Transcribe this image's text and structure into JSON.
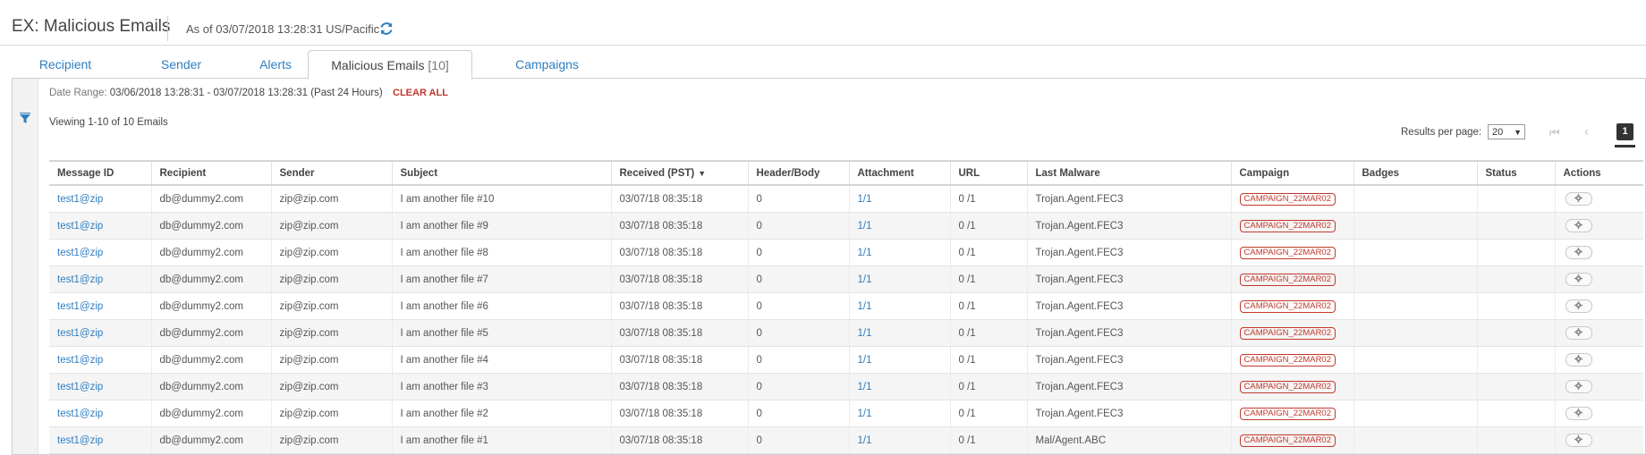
{
  "header": {
    "title": "EX: Malicious Emails",
    "as_of": "As of 03/07/2018 13:28:31 US/Pacific",
    "refresh_icon": "refresh-icon"
  },
  "tabs": [
    {
      "label": "Recipient",
      "count": ""
    },
    {
      "label": "Sender",
      "count": ""
    },
    {
      "label": "Alerts",
      "count": ""
    },
    {
      "label": "Malicious Emails",
      "count": "[10]"
    },
    {
      "label": "Campaigns",
      "count": ""
    }
  ],
  "filters": {
    "date_range_label": "Date Range:",
    "date_range_value": "03/06/2018 13:28:31 - 03/07/2018 13:28:31 (Past 24 Hours)",
    "clear_all": "CLEAR ALL"
  },
  "viewing": "Viewing 1-10 of 10 Emails",
  "pagination": {
    "results_per_page_label": "Results per page:",
    "results_per_page": "20",
    "current_page": "1"
  },
  "table": {
    "columns": [
      "Message ID",
      "Recipient",
      "Sender",
      "Subject",
      "Received (PST)",
      "Header/Body",
      "Attachment",
      "URL",
      "Last Malware",
      "Campaign",
      "Badges",
      "Status",
      "Actions"
    ],
    "rows": [
      {
        "message_id": "test1@zip",
        "recipient": "db@dummy2.com",
        "sender": "zip@zip.com",
        "subject": "I am another file #10",
        "received": "03/07/18 08:35:18",
        "header_body": "0",
        "attachment": "1/1",
        "url": "0 /1",
        "last_malware": "Trojan.Agent.FEC3",
        "campaign": "CAMPAIGN_22MAR02"
      },
      {
        "message_id": "test1@zip",
        "recipient": "db@dummy2.com",
        "sender": "zip@zip.com",
        "subject": "I am another file #9",
        "received": "03/07/18 08:35:18",
        "header_body": "0",
        "attachment": "1/1",
        "url": "0 /1",
        "last_malware": "Trojan.Agent.FEC3",
        "campaign": "CAMPAIGN_22MAR02"
      },
      {
        "message_id": "test1@zip",
        "recipient": "db@dummy2.com",
        "sender": "zip@zip.com",
        "subject": "I am another file #8",
        "received": "03/07/18 08:35:18",
        "header_body": "0",
        "attachment": "1/1",
        "url": "0 /1",
        "last_malware": "Trojan.Agent.FEC3",
        "campaign": "CAMPAIGN_22MAR02"
      },
      {
        "message_id": "test1@zip",
        "recipient": "db@dummy2.com",
        "sender": "zip@zip.com",
        "subject": "I am another file #7",
        "received": "03/07/18 08:35:18",
        "header_body": "0",
        "attachment": "1/1",
        "url": "0 /1",
        "last_malware": "Trojan.Agent.FEC3",
        "campaign": "CAMPAIGN_22MAR02"
      },
      {
        "message_id": "test1@zip",
        "recipient": "db@dummy2.com",
        "sender": "zip@zip.com",
        "subject": "I am another file #6",
        "received": "03/07/18 08:35:18",
        "header_body": "0",
        "attachment": "1/1",
        "url": "0 /1",
        "last_malware": "Trojan.Agent.FEC3",
        "campaign": "CAMPAIGN_22MAR02"
      },
      {
        "message_id": "test1@zip",
        "recipient": "db@dummy2.com",
        "sender": "zip@zip.com",
        "subject": "I am another file #5",
        "received": "03/07/18 08:35:18",
        "header_body": "0",
        "attachment": "1/1",
        "url": "0 /1",
        "last_malware": "Trojan.Agent.FEC3",
        "campaign": "CAMPAIGN_22MAR02"
      },
      {
        "message_id": "test1@zip",
        "recipient": "db@dummy2.com",
        "sender": "zip@zip.com",
        "subject": "I am another file #4",
        "received": "03/07/18 08:35:18",
        "header_body": "0",
        "attachment": "1/1",
        "url": "0 /1",
        "last_malware": "Trojan.Agent.FEC3",
        "campaign": "CAMPAIGN_22MAR02"
      },
      {
        "message_id": "test1@zip",
        "recipient": "db@dummy2.com",
        "sender": "zip@zip.com",
        "subject": "I am another file #3",
        "received": "03/07/18 08:35:18",
        "header_body": "0",
        "attachment": "1/1",
        "url": "0 /1",
        "last_malware": "Trojan.Agent.FEC3",
        "campaign": "CAMPAIGN_22MAR02"
      },
      {
        "message_id": "test1@zip",
        "recipient": "db@dummy2.com",
        "sender": "zip@zip.com",
        "subject": "I am another file #2",
        "received": "03/07/18 08:35:18",
        "header_body": "0",
        "attachment": "1/1",
        "url": "0 /1",
        "last_malware": "Trojan.Agent.FEC3",
        "campaign": "CAMPAIGN_22MAR02"
      },
      {
        "message_id": "test1@zip",
        "recipient": "db@dummy2.com",
        "sender": "zip@zip.com",
        "subject": "I am another file #1",
        "received": "03/07/18 08:35:18",
        "header_body": "0",
        "attachment": "1/1",
        "url": "0 /1",
        "last_malware": "Mal/Agent.ABC",
        "campaign": "CAMPAIGN_22MAR02"
      }
    ]
  },
  "colors": {
    "link": "#2f7ec0",
    "badge_red": "#c0392b",
    "clear_all": "#c0392b"
  }
}
